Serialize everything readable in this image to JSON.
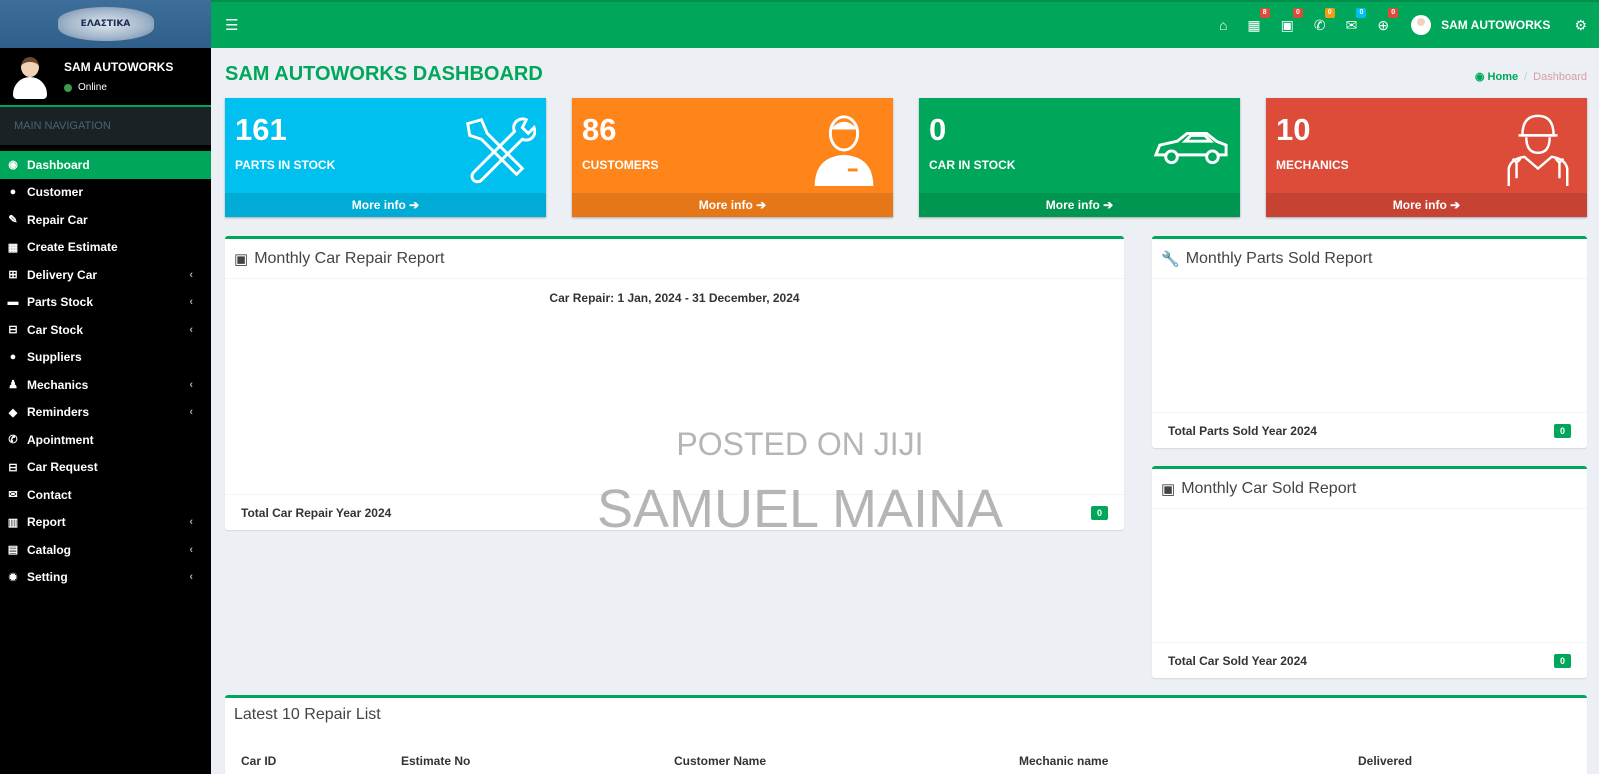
{
  "logo": {
    "text": "ΕΛΑΣΤΙΚΑ"
  },
  "user": {
    "name": "SAM AUTOWORKS",
    "status": "Online"
  },
  "sidebar": {
    "header": "MAIN NAVIGATION",
    "items": [
      {
        "label": "Dashboard",
        "icon": "dashboard-icon",
        "glyph": "◉",
        "submenu": false
      },
      {
        "label": "Customer",
        "icon": "user-icon",
        "glyph": "●",
        "submenu": false
      },
      {
        "label": "Repair Car",
        "icon": "wrench-icon",
        "glyph": "✎",
        "submenu": false
      },
      {
        "label": "Create Estimate",
        "icon": "calculator-icon",
        "glyph": "▦",
        "submenu": false
      },
      {
        "label": "Delivery Car",
        "icon": "cart-icon",
        "glyph": "⊞",
        "submenu": true
      },
      {
        "label": "Parts Stock",
        "icon": "truck-icon",
        "glyph": "▬",
        "submenu": true
      },
      {
        "label": "Car Stock",
        "icon": "car-icon",
        "glyph": "⊟",
        "submenu": true
      },
      {
        "label": "Suppliers",
        "icon": "user-icon",
        "glyph": "●",
        "submenu": false
      },
      {
        "label": "Mechanics",
        "icon": "users-icon",
        "glyph": "♟",
        "submenu": true
      },
      {
        "label": "Reminders",
        "icon": "comment-icon",
        "glyph": "◆",
        "submenu": true
      },
      {
        "label": "Apointment",
        "icon": "phone-icon",
        "glyph": "✆",
        "submenu": false
      },
      {
        "label": "Car Request",
        "icon": "car-icon",
        "glyph": "⊟",
        "submenu": false
      },
      {
        "label": "Contact",
        "icon": "envelope-icon",
        "glyph": "✉",
        "submenu": false
      },
      {
        "label": "Report",
        "icon": "bar-chart-icon",
        "glyph": "▥",
        "submenu": true
      },
      {
        "label": "Catalog",
        "icon": "file-icon",
        "glyph": "▤",
        "submenu": true
      },
      {
        "label": "Setting",
        "icon": "gear-icon",
        "glyph": "✹",
        "submenu": true
      }
    ]
  },
  "topbar": {
    "badges": {
      "calculator": "8",
      "car": "0",
      "phone": "0",
      "mail": "0",
      "cart": "0"
    },
    "user_name": "SAM AUTOWORKS"
  },
  "page": {
    "title": "SAM AUTOWORKS DASHBOARD",
    "breadcrumb_home": "Home",
    "breadcrumb_current": "Dashboard"
  },
  "stats": [
    {
      "value": "161",
      "label": "PARTS IN STOCK",
      "more": "More info ➔",
      "color": "#00c0ef"
    },
    {
      "value": "86",
      "label": "CUSTOMERS",
      "more": "More info ➔",
      "color": "#ff851b"
    },
    {
      "value": "0",
      "label": "CAR IN STOCK",
      "more": "More info ➔",
      "color": "#00a65a"
    },
    {
      "value": "10",
      "label": "MECHANICS",
      "more": "More info ➔",
      "color": "#dd4b39"
    }
  ],
  "repair_report": {
    "title": "Monthly Car Repair Report",
    "subtitle": "Car Repair: 1 Jan, 2024 - 31 December, 2024",
    "total_label": "Total Car Repair Year 2024",
    "total_value": "0"
  },
  "parts_report": {
    "title": "Monthly Parts Sold Report",
    "total_label": "Total Parts Sold Year 2024",
    "total_value": "0"
  },
  "car_sold_report": {
    "title": "Monthly Car Sold Report",
    "total_label": "Total Car Sold Year 2024",
    "total_value": "0"
  },
  "repair_list": {
    "title": "Latest 10 Repair List",
    "columns": [
      "Car ID",
      "Estimate No",
      "Customer Name",
      "Mechanic name",
      "Delivered"
    ]
  },
  "watermark": {
    "line1": "POSTED ON JIJI",
    "line2": "SAMUEL MAINA"
  }
}
